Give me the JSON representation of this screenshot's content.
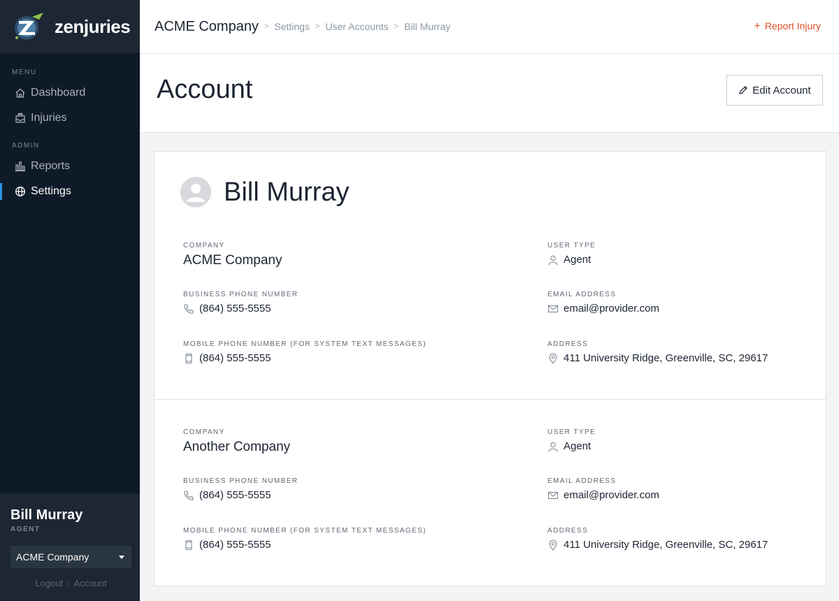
{
  "app": {
    "logo_text": "zenjuries",
    "brand_color": "#e0502c",
    "accent_color": "#2d8fe0"
  },
  "sidebar": {
    "menu_heading": "MENU",
    "menu_items": [
      {
        "label": "Dashboard",
        "icon": "home-icon"
      },
      {
        "label": "Injuries",
        "icon": "inbox-icon"
      }
    ],
    "admin_heading": "ADMIN",
    "admin_items": [
      {
        "label": "Reports",
        "icon": "bar-chart-icon"
      },
      {
        "label": "Settings",
        "icon": "globe-icon",
        "active": true
      }
    ],
    "user": {
      "name": "Bill Murray",
      "role": "AGENT",
      "company_selected": "ACME Company",
      "logout_label": "Logout",
      "account_label": "Account"
    }
  },
  "header": {
    "breadcrumb": [
      "ACME Company",
      "Settings",
      "User Accounts",
      "Bill Murray"
    ],
    "report_injury_label": "Report Injury"
  },
  "page": {
    "title": "Account",
    "edit_button_label": "Edit Account"
  },
  "profile": {
    "name": "Bill Murray",
    "companies": [
      {
        "company_label": "COMPANY",
        "company": "ACME Company",
        "user_type_label": "USER TYPE",
        "user_type": "Agent",
        "business_phone_label": "BUSINESS PHONE NUMBER",
        "business_phone": "(864) 555-5555",
        "email_label": "EMAIL ADDRESS",
        "email": "email@provider.com",
        "mobile_phone_label": "MOBILE PHONE NUMBER (FOR SYSTEM TEXT MESSAGES)",
        "mobile_phone": "(864) 555-5555",
        "address_label": "ADDRESS",
        "address": "411 University Ridge, Greenville, SC, 29617"
      },
      {
        "company_label": "COMPANY",
        "company": "Another Company",
        "user_type_label": "USER TYPE",
        "user_type": "Agent",
        "business_phone_label": "BUSINESS PHONE NUMBER",
        "business_phone": "(864) 555-5555",
        "email_label": "EMAIL ADDRESS",
        "email": "email@provider.com",
        "mobile_phone_label": "MOBILE PHONE NUMBER (FOR SYSTEM TEXT MESSAGES)",
        "mobile_phone": "(864) 555-5555",
        "address_label": "ADDRESS",
        "address": "411 University Ridge, Greenville, SC, 29617"
      }
    ]
  }
}
